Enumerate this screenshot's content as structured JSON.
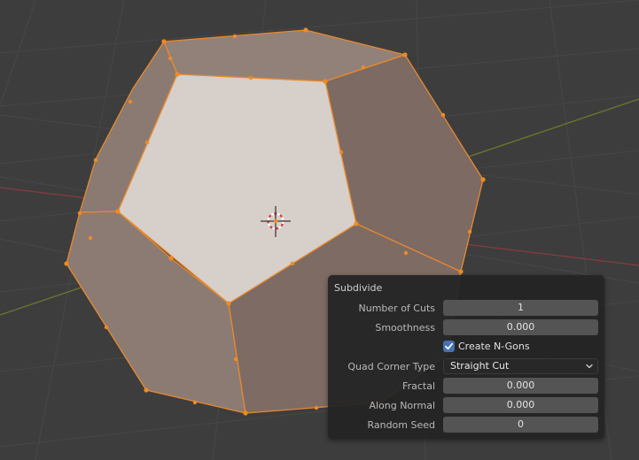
{
  "viewport": {
    "object": "dodecahedron",
    "edge_color": "#e8892c",
    "active_face_color": "#d4cdc8",
    "icon": "3d-cursor-icon"
  },
  "operator_panel": {
    "title": "Subdivide",
    "rows": [
      {
        "label": "Number of Cuts",
        "value": "1"
      },
      {
        "label": "Smoothness",
        "value": "0.000"
      },
      {
        "checkbox_label": "Create N-Gons",
        "checked": true
      },
      {
        "label": "Quad Corner Type",
        "value": "Straight Cut",
        "type": "dropdown"
      },
      {
        "label": "Fractal",
        "value": "0.000"
      },
      {
        "label": "Along Normal",
        "value": "0.000"
      },
      {
        "label": "Random Seed",
        "value": "0"
      }
    ]
  }
}
